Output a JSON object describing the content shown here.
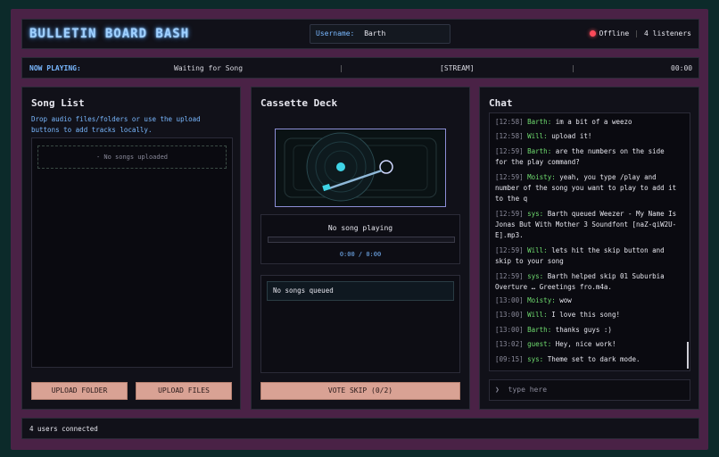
{
  "header": {
    "title": "BULLETIN BOARD BASH",
    "username_label": "Username:",
    "username_value": "Barth",
    "status_text": "Offline",
    "separator": "|",
    "listeners": "4 listeners",
    "status_color": "#ff4a5a"
  },
  "now_playing": {
    "label": "NOW PLAYING:",
    "song": "Waiting for Song",
    "stream": "[STREAM]",
    "time": "00:00",
    "separator": "|"
  },
  "song_list": {
    "title": "Song List",
    "hint": "Drop audio files/folders or use the upload buttons to add tracks locally.",
    "empty": "- No songs uploaded",
    "upload_folder": "UPLOAD FOLDER",
    "upload_files": "UPLOAD FILES"
  },
  "cassette": {
    "title": "Cassette Deck",
    "song_title": "No song playing",
    "time": "0:00 / 0:00",
    "progress": 0,
    "queue_empty": "No songs queued",
    "vote_skip": "VOTE SKIP (0/2)"
  },
  "chat": {
    "title": "Chat",
    "messages": [
      {
        "ts": "[12:58]",
        "who": "Barth:",
        "text": "im a bit of a weezo"
      },
      {
        "ts": "[12:58]",
        "who": "Will:",
        "text": "upload it!"
      },
      {
        "ts": "[12:59]",
        "who": "Barth:",
        "text": "are the numbers on the side for the play command?"
      },
      {
        "ts": "[12:59]",
        "who": "Moisty:",
        "text": "yeah, you type /play and number of the song you want to play to add it to the q"
      },
      {
        "ts": "[12:59]",
        "who": "sys:",
        "text": "Barth queued Weezer - My Name Is Jonas But With Mother 3 Soundfont [naZ-qiW2U-E].mp3."
      },
      {
        "ts": "[12:59]",
        "who": "Will:",
        "text": "lets hit the skip button and skip to your song"
      },
      {
        "ts": "[12:59]",
        "who": "sys:",
        "text": "Barth helped skip 01 Suburbia Overture … Greetings fro.m4a."
      },
      {
        "ts": "[13:00]",
        "who": "Moisty:",
        "text": "wow"
      },
      {
        "ts": "[13:00]",
        "who": "Will:",
        "text": "I love this song!"
      },
      {
        "ts": "[13:00]",
        "who": "Barth:",
        "text": "thanks guys :)"
      },
      {
        "ts": "[13:02]",
        "who": "guest:",
        "text": "Hey, nice work!"
      },
      {
        "ts": "[09:15]",
        "who": "sys:",
        "text": "Theme set to dark mode."
      }
    ],
    "prompt": "❯",
    "input_placeholder": "type here"
  },
  "footer": {
    "users_connected": "4 users connected"
  }
}
